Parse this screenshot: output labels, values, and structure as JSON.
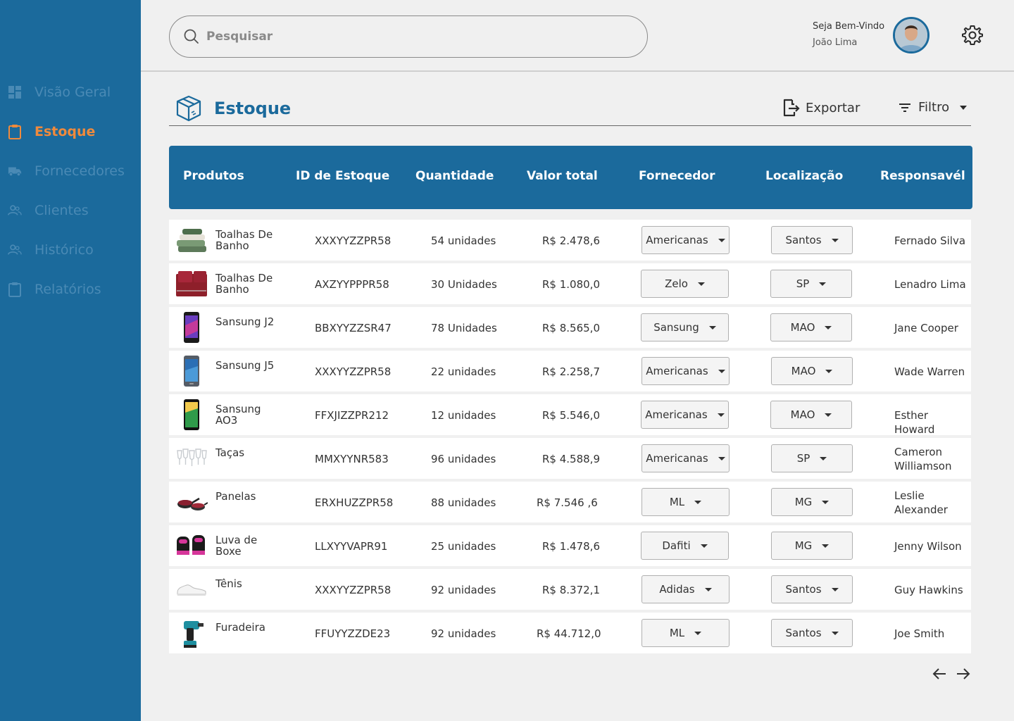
{
  "sidebar": {
    "items": [
      {
        "label": "Visão Geral",
        "icon": "dashboard-icon",
        "active": false
      },
      {
        "label": "Estoque",
        "icon": "clipboard-icon",
        "active": true
      },
      {
        "label": "Fornecedores",
        "icon": "truck-icon",
        "active": false
      },
      {
        "label": "Clientes",
        "icon": "users-icon",
        "active": false
      },
      {
        "label": "Histórico",
        "icon": "users-icon",
        "active": false
      },
      {
        "label": "Relatórios",
        "icon": "clipboard-icon",
        "active": false
      }
    ]
  },
  "header": {
    "search_placeholder": "Pesquisar",
    "welcome": "Seja Bem-Vindo",
    "user_name": "João Lima"
  },
  "page": {
    "title": "Estoque",
    "export_label": "Exportar",
    "filter_label": "Filtro"
  },
  "table": {
    "columns": [
      "Produtos",
      "ID de Estoque",
      "Quantidade",
      "Valor total",
      "Fornecedor",
      "Localização",
      "Responsavél"
    ],
    "rows": [
      {
        "product": "Toalhas De Banho",
        "thumb": "towel-green",
        "id": "XXXYYZZPR58",
        "qty": "54 unidades",
        "value": "R$ 2.478,6",
        "supplier": "Americanas",
        "location": "Santos",
        "owner": "Fernado Silva"
      },
      {
        "product": "Toalhas De Banho",
        "thumb": "towel-red",
        "id": "AXZYYPPPR58",
        "qty": "30 Unidades",
        "value": "R$ 1.080,0",
        "supplier": "Zelo",
        "location": "SP",
        "owner": "Lenadro Lima"
      },
      {
        "product": "Sansung J2",
        "thumb": "phone-purple",
        "id": "BBXYYZZSR47",
        "qty": "78 Unidades",
        "value": "R$ 8.565,0",
        "supplier": "Sansung",
        "location": "MAO",
        "owner": "Jane Cooper"
      },
      {
        "product": "Sansung J5",
        "thumb": "phone-blue",
        "id": "XXXYYZZPR58",
        "qty": "22 unidades",
        "value": "R$ 2.258,7",
        "supplier": "Americanas",
        "location": "MAO",
        "owner": "Wade Warren"
      },
      {
        "product": "Sansung AO3",
        "thumb": "phone-green",
        "id": "FFXJIZZPR212",
        "qty": "12 unidades",
        "value": "R$ 5.546,0",
        "supplier": "Americanas",
        "location": "MAO",
        "owner": "Esther Howard"
      },
      {
        "product": "Taças",
        "thumb": "glasses",
        "id": "MMXYYNR583",
        "qty": "96 unidades",
        "value": "R$ 4.588,9",
        "supplier": "Americanas",
        "location": "SP",
        "owner": "Cameron Williamson"
      },
      {
        "product": "Panelas",
        "thumb": "pans",
        "id": "ERXHUZZPR58",
        "qty": "88 unidades",
        "value": "R$ 7.546 ,6",
        "supplier": "ML",
        "location": "MG",
        "owner": "Leslie Alexander"
      },
      {
        "product": "Luva de Boxe",
        "thumb": "gloves",
        "id": "LLXYYVAPR91",
        "qty": "25 unidades",
        "value": "R$ 1.478,6",
        "supplier": "Dafiti",
        "location": "MG",
        "owner": "Jenny Wilson"
      },
      {
        "product": "Tênis",
        "thumb": "sneaker",
        "id": "XXXYYZZPR58",
        "qty": "92 unidades",
        "value": "R$ 8.372,1",
        "supplier": "Adidas",
        "location": "Santos",
        "owner": "Guy Hawkins"
      },
      {
        "product": "Furadeira",
        "thumb": "drill",
        "id": "FFUYYZZDE23",
        "qty": "92 unidades",
        "value": "R$ 44.712,0",
        "supplier": "ML",
        "location": "Santos",
        "owner": "Joe Smith"
      }
    ]
  },
  "colors": {
    "primary": "#1b6a9c",
    "accent": "#f08a3c",
    "background": "#f0f0f0"
  }
}
